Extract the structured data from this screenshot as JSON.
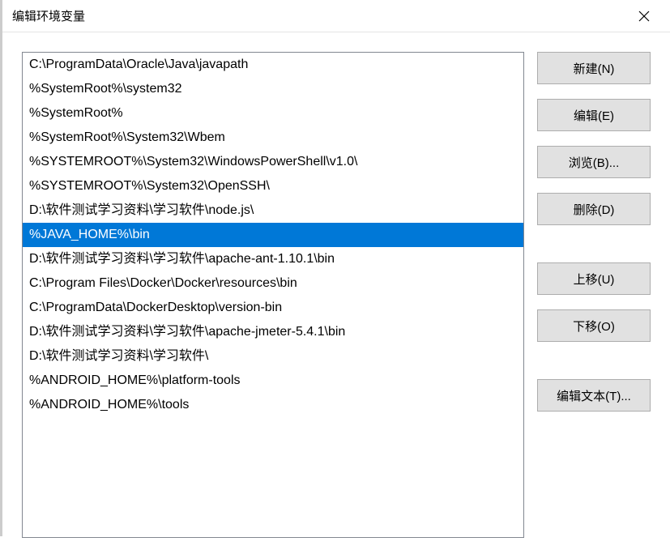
{
  "window": {
    "title": "编辑环境变量"
  },
  "list": {
    "items": [
      "C:\\ProgramData\\Oracle\\Java\\javapath",
      "%SystemRoot%\\system32",
      "%SystemRoot%",
      "%SystemRoot%\\System32\\Wbem",
      "%SYSTEMROOT%\\System32\\WindowsPowerShell\\v1.0\\",
      "%SYSTEMROOT%\\System32\\OpenSSH\\",
      "D:\\软件测试学习资料\\学习软件\\node.js\\",
      "%JAVA_HOME%\\bin",
      "D:\\软件测试学习资料\\学习软件\\apache-ant-1.10.1\\bin",
      "C:\\Program Files\\Docker\\Docker\\resources\\bin",
      "C:\\ProgramData\\DockerDesktop\\version-bin",
      "D:\\软件测试学习资料\\学习软件\\apache-jmeter-5.4.1\\bin",
      "D:\\软件测试学习资料\\学习软件\\",
      "%ANDROID_HOME%\\platform-tools",
      "%ANDROID_HOME%\\tools"
    ],
    "selected_index": 7
  },
  "buttons": {
    "new": "新建(N)",
    "edit": "编辑(E)",
    "browse": "浏览(B)...",
    "delete": "删除(D)",
    "move_up": "上移(U)",
    "move_down": "下移(O)",
    "edit_text": "编辑文本(T)..."
  }
}
